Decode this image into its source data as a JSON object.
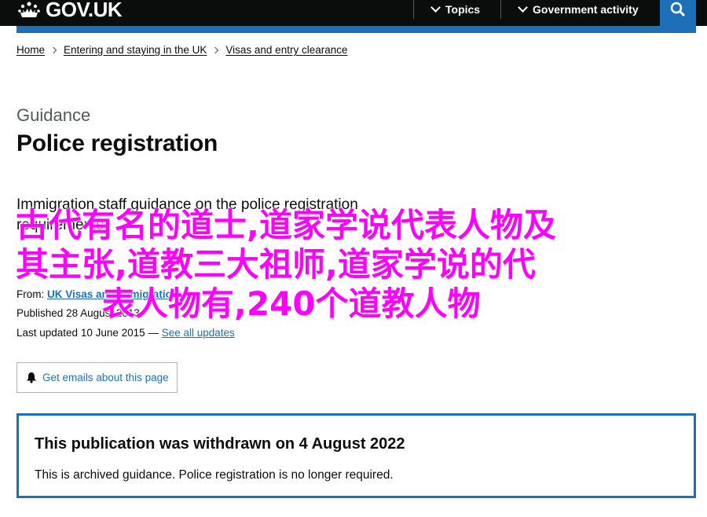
{
  "header": {
    "logo_text": "GOV.UK",
    "nav": [
      {
        "label": "Topics"
      },
      {
        "label": "Government activity"
      }
    ],
    "colors": {
      "bar": "#0b0c0c",
      "accent": "#1d70b8"
    }
  },
  "breadcrumb": [
    "Home",
    "Entering and staying in the UK",
    "Visas and entry clearance"
  ],
  "page": {
    "caption": "Guidance",
    "title": "Police registration",
    "summary": "Immigration staff guidance on the police registration requirements."
  },
  "meta": {
    "from_label": "From:",
    "from_value": "UK Visas and Immigration",
    "published_label": "Published",
    "published_value": "28 August 2013",
    "updated_label": "Last updated",
    "updated_value": "10 June 2015",
    "updated_sep": "—",
    "see_all": "See all updates"
  },
  "email_button": {
    "label": "Get emails about this page",
    "icon": "bell-icon"
  },
  "withdrawn": {
    "heading": "This publication was withdrawn on 4 August 2022",
    "body": "This is archived guidance. Police registration is no longer required."
  },
  "overlay": {
    "line1": "古代有名的道士,道家学说代表人物及",
    "line2": "其主张,道教三大祖师,道家学说的代",
    "line3": "表人物有,240个道教人物",
    "color": "#ff00ff"
  }
}
